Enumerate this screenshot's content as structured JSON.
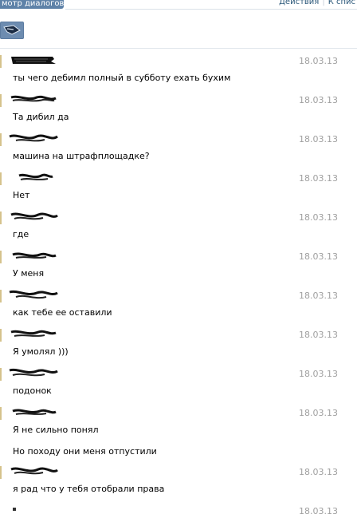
{
  "header": {
    "tab_label": "мотр диалогов",
    "actions_label": "Действия",
    "back_to_list_label": "К спис"
  },
  "messages": [
    {
      "date": "18.03.13",
      "text": "ты чего дебимл полный в субботу ехать бухим"
    },
    {
      "date": "18.03.13",
      "text": "Та дибил да"
    },
    {
      "date": "18.03.13",
      "text": "машина на штрафплощадке?"
    },
    {
      "date": "18.03.13",
      "text": "Нет"
    },
    {
      "date": "18.03.13",
      "text": "где"
    },
    {
      "date": "18.03.13",
      "text": "У меня"
    },
    {
      "date": "18.03.13",
      "text": "как тебе ее оставили"
    },
    {
      "date": "18.03.13",
      "text": "Я умолял )))"
    },
    {
      "date": "18.03.13",
      "text": "подонок"
    },
    {
      "date": "18.03.13",
      "text": "Я не сильно понял"
    },
    {
      "date": "",
      "text": "Но походу они меня отпустили"
    },
    {
      "date": "18.03.13",
      "text": "я рад что у тебя отобрали права"
    },
    {
      "date": "18.03.13",
      "text": ""
    }
  ],
  "icons": {
    "back": "back-arrow-icon",
    "author_scribble": "censored-author-icon"
  },
  "colors": {
    "tab_bg": "#5e82a8",
    "link": "#2b587a",
    "date": "#a0a0a0",
    "accent_bar": "#d5c28c"
  }
}
